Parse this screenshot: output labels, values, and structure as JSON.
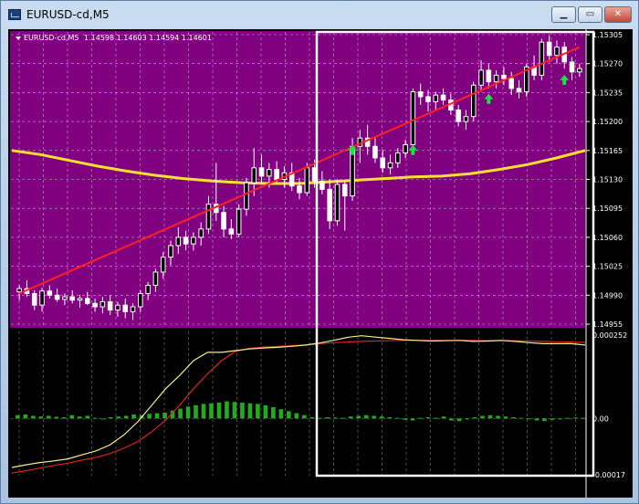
{
  "window": {
    "title": "EURUSD-cd,M5",
    "min_glyph": "▁",
    "max_glyph": "▭",
    "close_glyph": "✕"
  },
  "chart_header": {
    "symbol": "EURUSD-cd,M5",
    "ohlc": "1.14598 1.14603 1.14594 1.14601"
  },
  "colors": {
    "main_bg": "#800080",
    "sub_bg": "#000000",
    "grid": "#c8c8c8",
    "trend": "#ff2020",
    "ma": "#ffe030",
    "bull": "#ffffff",
    "bear": "#ffffff",
    "arrows": "#22dd44",
    "macd_fast": "#f4f08a",
    "macd_slow": "#e02020",
    "histogram": "#22aa22",
    "selection": "#ffffff"
  },
  "price_axis": [
    "1.15305",
    "1.15270",
    "1.15235",
    "1.15200",
    "1.15165",
    "1.15130",
    "1.15095",
    "1.15060",
    "1.15025",
    "1.14990",
    "1.14955"
  ],
  "indicator_axis": [
    "0.000252",
    "0.00",
    "-0.00017"
  ],
  "chart_data": {
    "type": "candlestick",
    "price_range": [
      1.14955,
      1.15305
    ],
    "indicator_range": [
      -0.00017,
      0.000252
    ],
    "candles": [
      [
        1.14994,
        1.15002,
        1.14984,
        1.14998
      ],
      [
        1.14998,
        1.15008,
        1.14988,
        1.14992
      ],
      [
        1.14992,
        1.14996,
        1.14972,
        1.14978
      ],
      [
        1.14978,
        1.14999,
        1.1497,
        1.14995
      ],
      [
        1.14995,
        1.15002,
        1.14986,
        1.1499
      ],
      [
        1.1499,
        1.14998,
        1.14982,
        1.14985
      ],
      [
        1.14985,
        1.14992,
        1.14978,
        1.14988
      ],
      [
        1.14988,
        1.14996,
        1.1498,
        1.14984
      ],
      [
        1.14984,
        1.1499,
        1.14975,
        1.14986
      ],
      [
        1.14986,
        1.14994,
        1.14978,
        1.1498
      ],
      [
        1.1498,
        1.14986,
        1.1497,
        1.14976
      ],
      [
        1.14976,
        1.14988,
        1.14968,
        1.14982
      ],
      [
        1.14982,
        1.1499,
        1.14966,
        1.14972
      ],
      [
        1.14972,
        1.14982,
        1.14964,
        1.14978
      ],
      [
        1.14978,
        1.14986,
        1.14962,
        1.1497
      ],
      [
        1.1497,
        1.1498,
        1.1496,
        1.14976
      ],
      [
        1.14976,
        1.14996,
        1.1497,
        1.14992
      ],
      [
        1.14992,
        1.15006,
        1.14984,
        1.15002
      ],
      [
        1.15002,
        1.15022,
        1.14994,
        1.15018
      ],
      [
        1.15018,
        1.15042,
        1.1501,
        1.15036
      ],
      [
        1.15036,
        1.15056,
        1.15026,
        1.1505
      ],
      [
        1.1505,
        1.15072,
        1.1504,
        1.1506
      ],
      [
        1.1506,
        1.15068,
        1.15044,
        1.15052
      ],
      [
        1.15052,
        1.15066,
        1.15044,
        1.1506
      ],
      [
        1.1506,
        1.15078,
        1.1505,
        1.1507
      ],
      [
        1.1507,
        1.1511,
        1.15064,
        1.151
      ],
      [
        1.151,
        1.1515,
        1.1508,
        1.1509
      ],
      [
        1.1509,
        1.15098,
        1.1506,
        1.1507
      ],
      [
        1.1507,
        1.15082,
        1.15058,
        1.15064
      ],
      [
        1.15064,
        1.151,
        1.1506,
        1.15094
      ],
      [
        1.15094,
        1.15132,
        1.15086,
        1.15126
      ],
      [
        1.15126,
        1.15168,
        1.1511,
        1.15144
      ],
      [
        1.15144,
        1.1516,
        1.15124,
        1.15134
      ],
      [
        1.15134,
        1.1515,
        1.1512,
        1.15142
      ],
      [
        1.15142,
        1.15152,
        1.15126,
        1.1513
      ],
      [
        1.1513,
        1.15146,
        1.1512,
        1.15138
      ],
      [
        1.15138,
        1.1515,
        1.15116,
        1.15122
      ],
      [
        1.15122,
        1.15132,
        1.15106,
        1.15114
      ],
      [
        1.15114,
        1.1515,
        1.1511,
        1.15144
      ],
      [
        1.15144,
        1.15154,
        1.1512,
        1.15128
      ],
      [
        1.15128,
        1.1514,
        1.15112,
        1.15118
      ],
      [
        1.15118,
        1.1513,
        1.1507,
        1.1508
      ],
      [
        1.1508,
        1.1513,
        1.15074,
        1.15124
      ],
      [
        1.15124,
        1.15128,
        1.15068,
        1.1511
      ],
      [
        1.1511,
        1.1518,
        1.15104,
        1.1517
      ],
      [
        1.1517,
        1.1519,
        1.1515,
        1.1518
      ],
      [
        1.1518,
        1.15196,
        1.1516,
        1.1517
      ],
      [
        1.1517,
        1.1518,
        1.1515,
        1.15156
      ],
      [
        1.15156,
        1.15166,
        1.15138,
        1.15144
      ],
      [
        1.15144,
        1.1516,
        1.15136,
        1.1515
      ],
      [
        1.1515,
        1.15168,
        1.15144,
        1.15162
      ],
      [
        1.15162,
        1.15178,
        1.15156,
        1.15172
      ],
      [
        1.15172,
        1.1524,
        1.15166,
        1.15236
      ],
      [
        1.15236,
        1.15246,
        1.1522,
        1.1523
      ],
      [
        1.1523,
        1.15238,
        1.15212,
        1.15224
      ],
      [
        1.15224,
        1.15236,
        1.15214,
        1.15232
      ],
      [
        1.15232,
        1.1524,
        1.1522,
        1.15226
      ],
      [
        1.15226,
        1.15234,
        1.15208,
        1.15214
      ],
      [
        1.15214,
        1.1522,
        1.15194,
        1.152
      ],
      [
        1.152,
        1.15214,
        1.1519,
        1.15206
      ],
      [
        1.15206,
        1.15248,
        1.152,
        1.15244
      ],
      [
        1.15244,
        1.15274,
        1.15236,
        1.15262
      ],
      [
        1.15262,
        1.1527,
        1.1524,
        1.15248
      ],
      [
        1.15248,
        1.15262,
        1.1524,
        1.15256
      ],
      [
        1.15256,
        1.15266,
        1.15244,
        1.15252
      ],
      [
        1.15252,
        1.1526,
        1.15232,
        1.1524
      ],
      [
        1.1524,
        1.1525,
        1.15228,
        1.15236
      ],
      [
        1.15236,
        1.1527,
        1.1523,
        1.15266
      ],
      [
        1.15266,
        1.1528,
        1.1525,
        1.15256
      ],
      [
        1.15256,
        1.153,
        1.1525,
        1.15296
      ],
      [
        1.15296,
        1.15304,
        1.15272,
        1.1528
      ],
      [
        1.1528,
        1.15298,
        1.1527,
        1.1529
      ],
      [
        1.1529,
        1.15296,
        1.15264,
        1.15272
      ],
      [
        1.15272,
        1.15278,
        1.1525,
        1.1526
      ],
      [
        1.1526,
        1.1527,
        1.15254,
        1.15264
      ]
    ],
    "trend_line": {
      "from": [
        0,
        1.14992
      ],
      "to": [
        74,
        1.1529
      ]
    },
    "moving_average": [
      1.15165,
      1.1516,
      1.15153,
      1.15146,
      1.1514,
      1.15135,
      1.15131,
      1.15128,
      1.15126,
      1.15125,
      1.15125,
      1.15127,
      1.15129,
      1.15131,
      1.15133,
      1.15134,
      1.15137,
      1.15142,
      1.15148,
      1.15156,
      1.15165
    ],
    "signal_arrows": [
      [
        44,
        1.15165
      ],
      [
        52,
        1.15165
      ],
      [
        62,
        1.15227
      ],
      [
        72,
        1.1525
      ]
    ],
    "macd_fast": [
      -0.000148,
      -0.00014,
      -0.000133,
      -0.000128,
      -0.000122,
      -0.00011,
      -9.8e-05,
      -8e-05,
      -5e-05,
      -1e-05,
      4e-05,
      9e-05,
      0.00013,
      0.000175,
      0.0002,
      0.0002,
      0.000205,
      0.00021,
      0.000213,
      0.000215,
      0.000218,
      0.000222,
      0.000228,
      0.000236,
      0.000245,
      0.00025,
      0.000246,
      0.000242,
      0.000238,
      0.000236,
      0.000234,
      0.000235,
      0.000236,
      0.000233,
      0.000234,
      0.000236,
      0.000233,
      0.000229,
      0.000226,
      0.000226,
      0.000226,
      0.000222
    ],
    "macd_slow": [
      -0.000165,
      -0.000158,
      -0.00015,
      -0.000142,
      -0.000135,
      -0.000126,
      -0.000118,
      -0.000106,
      -9e-05,
      -7e-05,
      -4e-05,
      -5e-06,
      4e-05,
      9e-05,
      0.000135,
      0.000175,
      0.000203,
      0.000212,
      0.000216,
      0.000218,
      0.00022,
      0.000222,
      0.000226,
      0.000229,
      0.000231,
      0.000233,
      0.000234,
      0.000235,
      0.000236,
      0.000236,
      0.000236,
      0.000236,
      0.000236,
      0.000236,
      0.000235,
      0.000235,
      0.000235,
      0.000234,
      0.000233,
      0.000232,
      0.000231,
      0.00023
    ],
    "histogram": [
      1e-05,
      1.2e-05,
      8e-06,
      6e-06,
      8e-06,
      5e-06,
      4e-06,
      1e-05,
      6e-06,
      8e-06,
      2e-06,
      -2e-06,
      4e-06,
      6e-06,
      8e-06,
      1.2e-05,
      1e-05,
      1.4e-05,
      1.6e-05,
      1.8e-05,
      2.4e-05,
      3e-05,
      3.6e-05,
      4e-05,
      4.4e-05,
      4.6e-05,
      4.8e-05,
      5.2e-05,
      5e-05,
      4.8e-05,
      4.6e-05,
      4.4e-05,
      4e-05,
      3.4e-05,
      2.8e-05,
      2.2e-05,
      1.6e-05,
      1e-05,
      4e-06,
      2e-06,
      4e-06,
      3e-06,
      2e-06,
      6e-06,
      8e-06,
      1e-05,
      8e-06,
      6e-06,
      4e-06,
      2e-06,
      -4e-06,
      -6e-06,
      2e-06,
      4e-06,
      2e-06,
      6e-06,
      -6e-06,
      -8e-06,
      -2e-06,
      4e-06,
      8e-06,
      1e-05,
      8e-06,
      6e-06,
      4e-06,
      2e-06,
      -2e-06,
      -6e-06,
      -8e-06,
      -4e-06,
      -2e-06,
      2e-06,
      3e-06,
      2e-06
    ],
    "grid": true
  }
}
